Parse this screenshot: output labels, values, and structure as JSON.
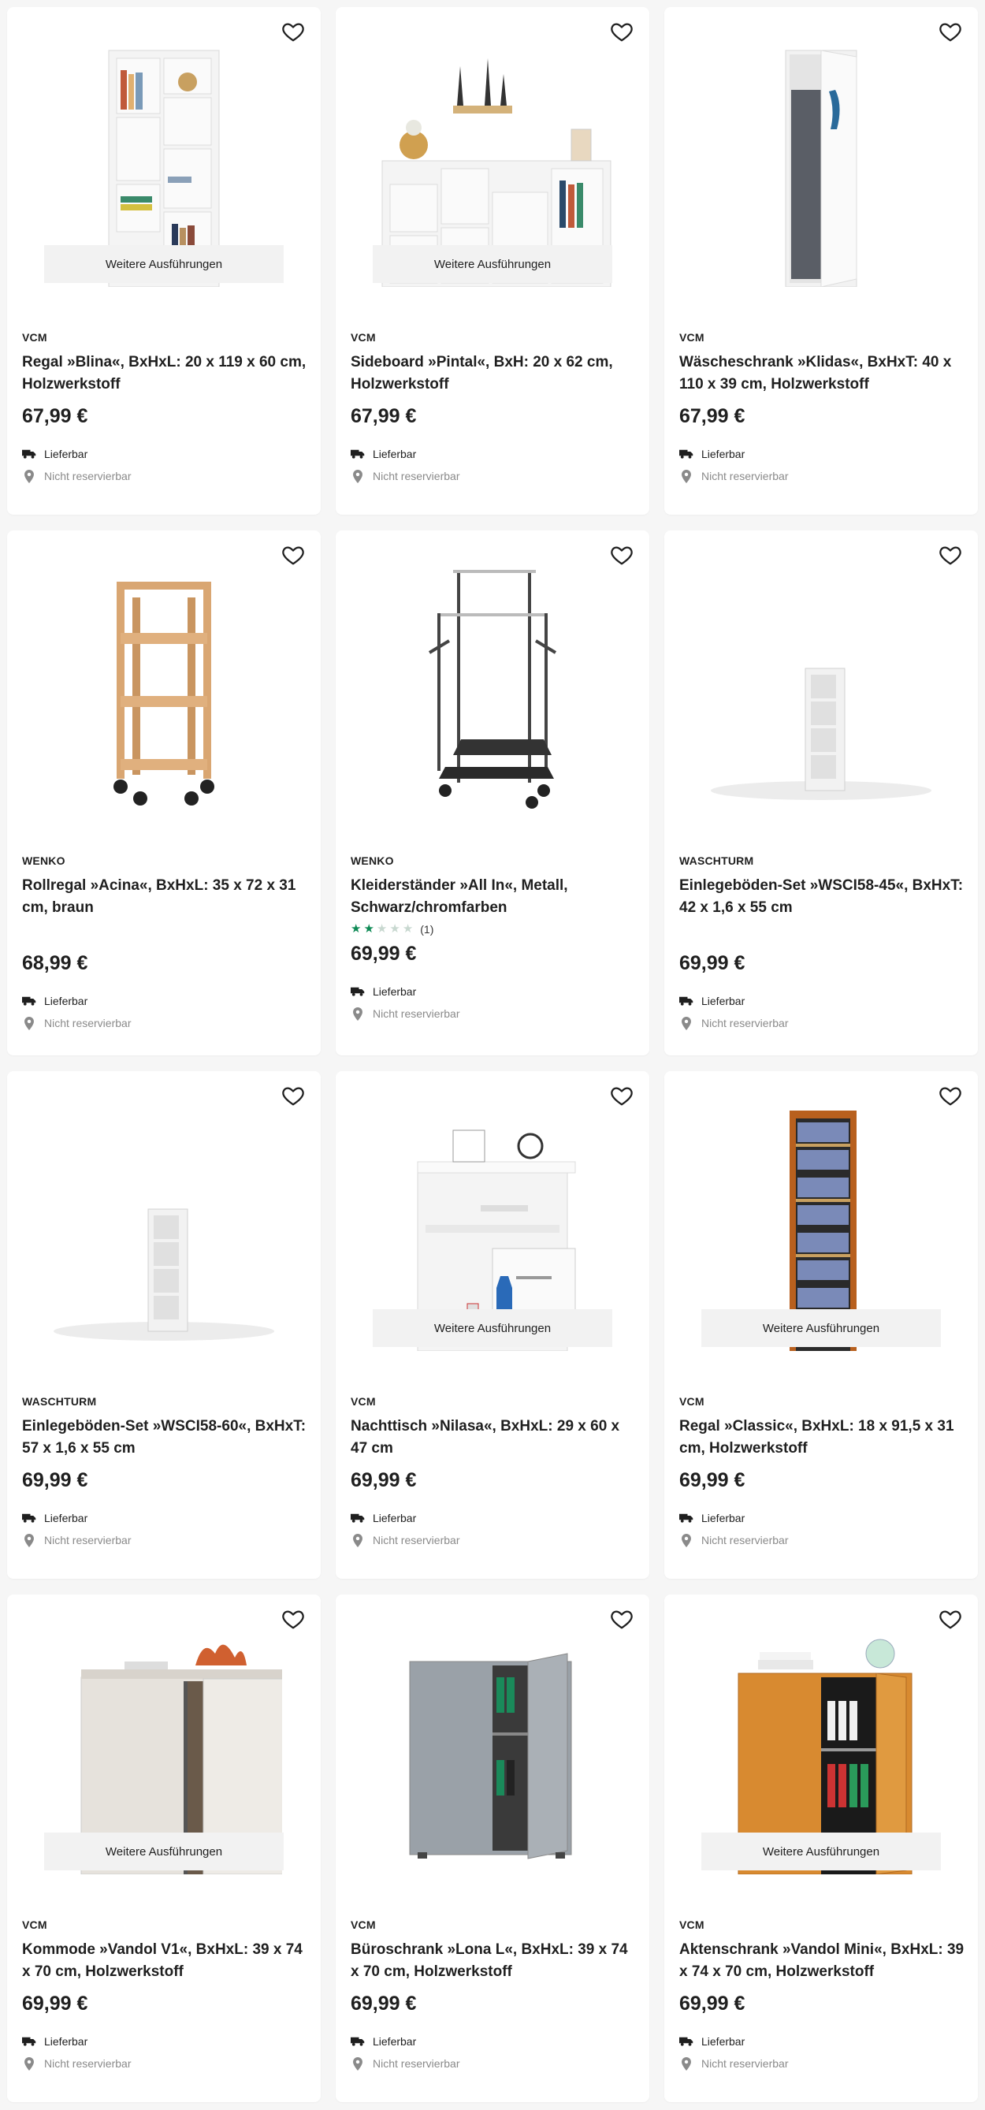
{
  "ui": {
    "more_label": "Weitere Ausführungen",
    "delivery_label": "Lieferbar",
    "reserve_label": "Nicht reservierbar",
    "star_on_color": "#0e8a55",
    "star_off_color": "#c8d8d0",
    "icons": {
      "favorite": "heart-outline-icon",
      "delivery": "truck-icon",
      "reserve": "location-pin-icon"
    }
  },
  "products": [
    {
      "brand": "VCM",
      "title": "Regal »Blina«, BxHxL: 20 x 119 x 60 cm, Holzwerkstoff",
      "price": "67,99 €",
      "more": true,
      "image": "white shelf unit"
    },
    {
      "brand": "VCM",
      "title": "Sideboard »Pintal«, BxH: 20 x 62 cm, Holzwerkstoff",
      "price": "67,99 €",
      "more": true,
      "image": "white sideboard shelf"
    },
    {
      "brand": "VCM",
      "title": "Wäscheschrank »Klidas«, BxHxT: 40 x 110 x 39 cm, Holzwerkstoff",
      "price": "67,99 €",
      "more": false,
      "image": "white laundry cabinet"
    },
    {
      "brand": "WENKO",
      "title": "Rollregal »Acina«, BxHxL: 35 x 72 x 31 cm, braun",
      "price": "68,99 €",
      "more": false,
      "image": "wooden rolling shelf"
    },
    {
      "brand": "WENKO",
      "title": "Kleiderständer »All In«, Metall, Schwarz/chromfarben",
      "price": "69,99 €",
      "more": false,
      "rating": {
        "stars": 2,
        "max": 5,
        "count": "(1)"
      },
      "image": "clothes rack"
    },
    {
      "brand": "WASCHTURM",
      "title": "Einlegeböden-Set »WSCI58-45«, BxHxT: 42 x 1,6 x 55 cm",
      "price": "69,99 €",
      "more": false,
      "image": "white shelf tower small"
    },
    {
      "brand": "WASCHTURM",
      "title": "Einlegeböden-Set »WSCI58-60«, BxHxT: 57 x 1,6 x 55 cm",
      "price": "69,99 €",
      "more": false,
      "image": "white shelf tower small"
    },
    {
      "brand": "VCM",
      "title": "Nachttisch »Nilasa«, BxHxL: 29 x 60 x 47 cm",
      "price": "69,99 €",
      "more": true,
      "image": "white nightstand"
    },
    {
      "brand": "VCM",
      "title": "Regal »Classic«, BxHxL: 18 x 91,5 x 31 cm, Holzwerkstoff",
      "price": "69,99 €",
      "more": true,
      "image": "wooden DVD shelf"
    },
    {
      "brand": "VCM",
      "title": "Kommode »Vandol V1«, BxHxL: 39 x 74 x 70 cm, Holzwerkstoff",
      "price": "69,99 €",
      "more": true,
      "image": "white cabinet"
    },
    {
      "brand": "VCM",
      "title": "Büroschrank »Lona L«, BxHxL: 39 x 74 x 70 cm, Holzwerkstoff",
      "price": "69,99 €",
      "more": false,
      "image": "grey office cabinet"
    },
    {
      "brand": "VCM",
      "title": "Aktenschrank »Vandol Mini«, BxHxL: 39 x 74 x 70 cm, Holzwerkstoff",
      "price": "69,99 €",
      "more": true,
      "image": "beech file cabinet"
    }
  ]
}
